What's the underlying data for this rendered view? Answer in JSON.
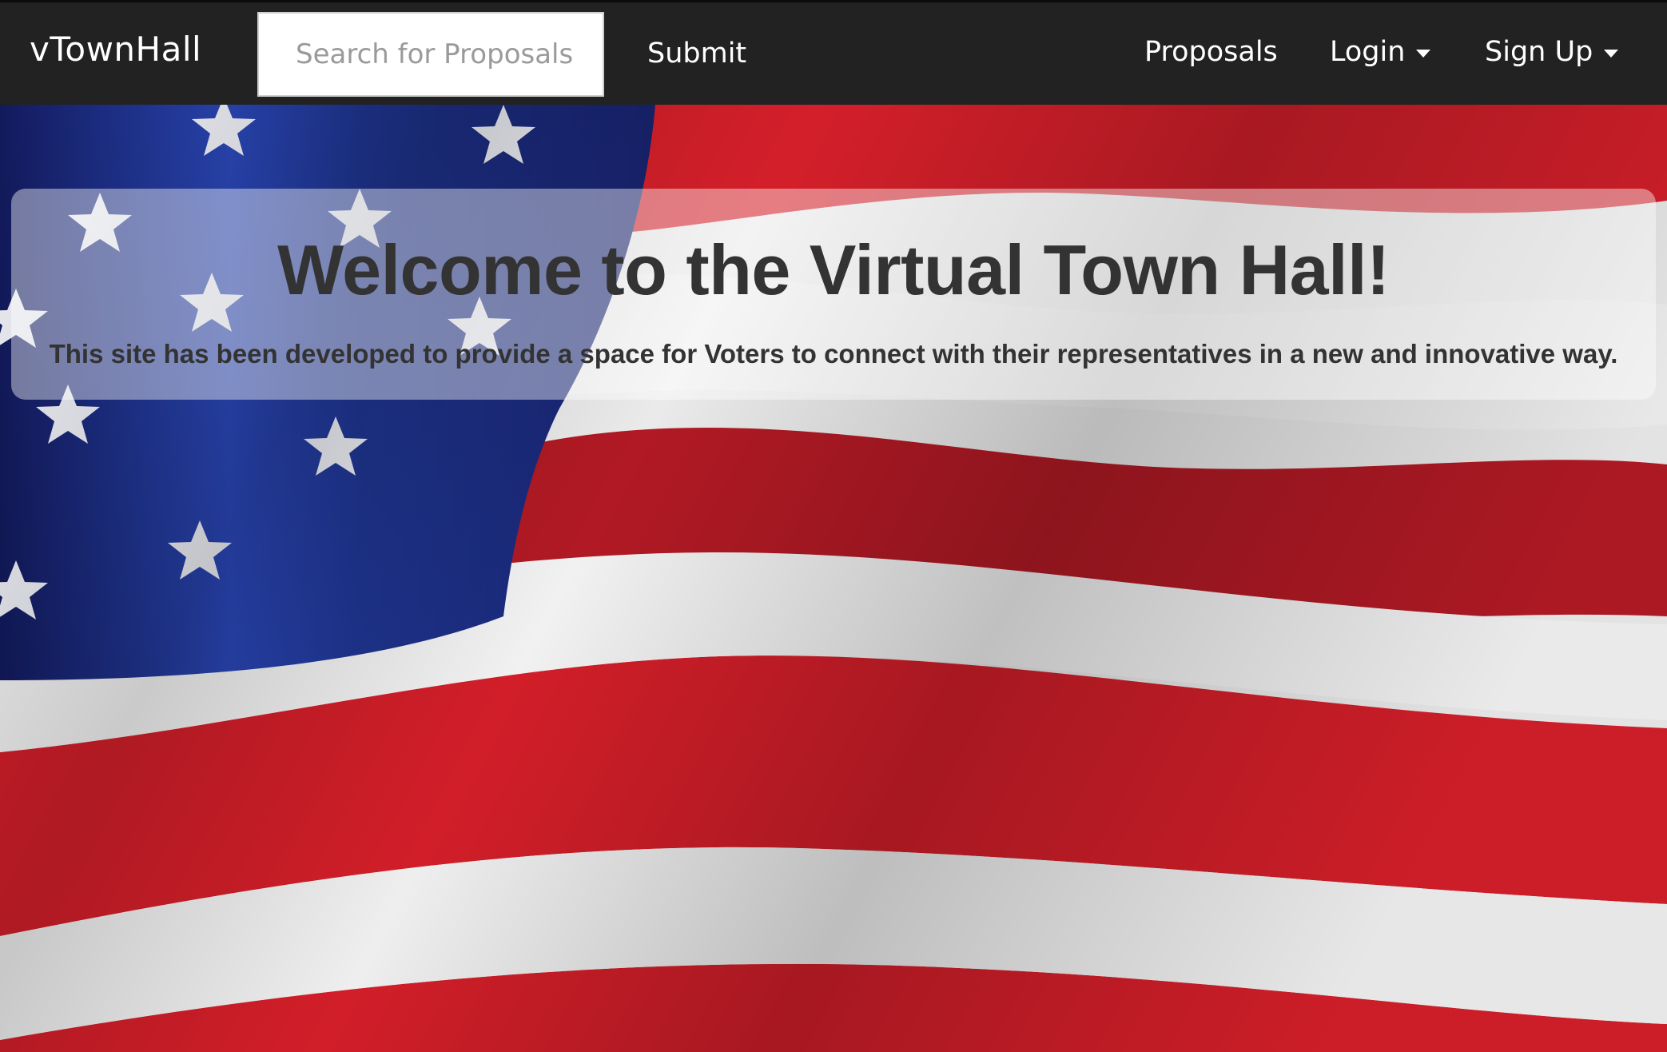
{
  "navbar": {
    "brand": "vTownHall",
    "search": {
      "placeholder": "Search for Proposals",
      "value": ""
    },
    "submit_label": "Submit",
    "links": [
      {
        "label": "Proposals",
        "dropdown": false
      },
      {
        "label": "Login",
        "dropdown": true
      },
      {
        "label": "Sign Up",
        "dropdown": true
      }
    ]
  },
  "hero": {
    "title": "Welcome to the Virtual Town Hall!",
    "subtitle": "This site has been developed to provide a space for Voters to connect with their representatives in a new and innovative way.",
    "background_image": "american-flag-waving"
  },
  "colors": {
    "navbar_bg": "#222222",
    "navbar_text": "#ffffff",
    "hero_text": "#333333",
    "flag_red": "#d61f2a",
    "flag_blue": "#1b2a7a",
    "flag_white": "#f2f2f2"
  }
}
